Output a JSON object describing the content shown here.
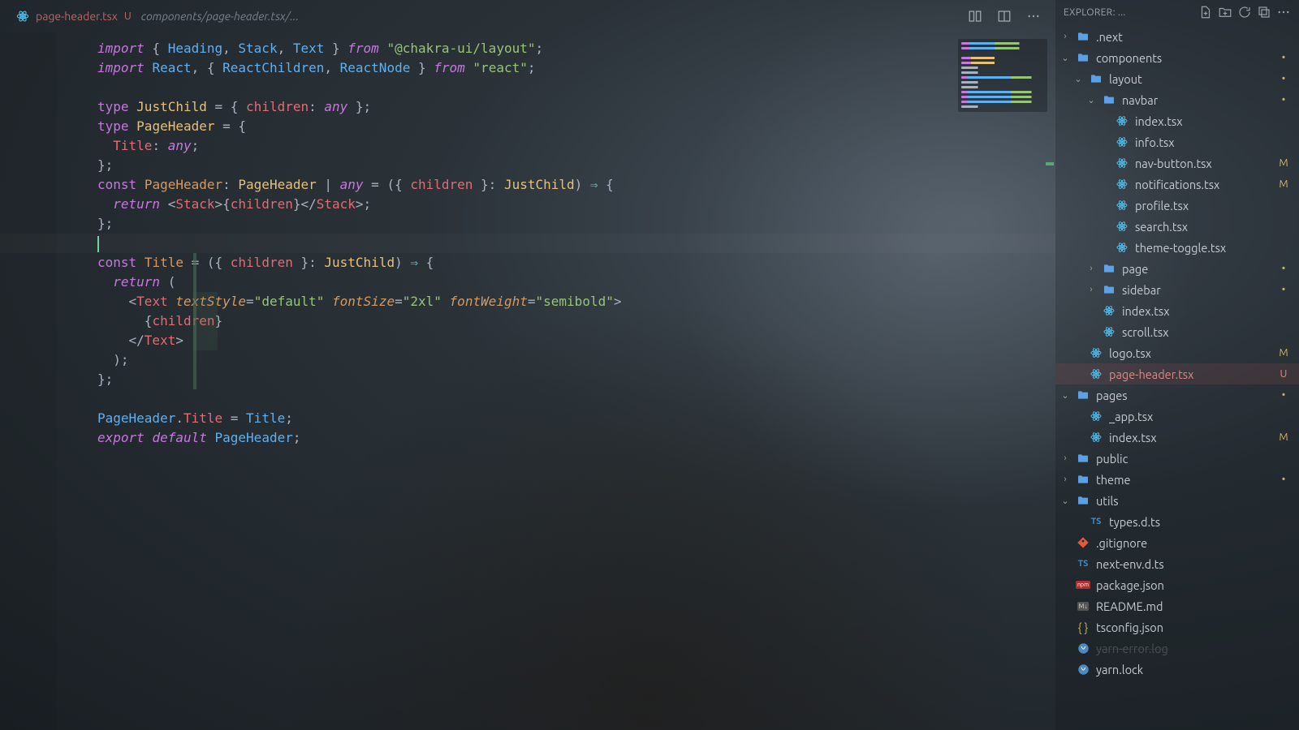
{
  "tab": {
    "filename": "page-header.tsx",
    "status": "U",
    "path": "components/page-header.tsx/..."
  },
  "explorer": {
    "title": "EXPLORER: ..."
  },
  "code_lines": [
    [
      [
        "k",
        "import"
      ],
      [
        "p",
        " { "
      ],
      [
        "fn",
        "Heading"
      ],
      [
        "p",
        ", "
      ],
      [
        "fn",
        "Stack"
      ],
      [
        "p",
        ", "
      ],
      [
        "fn",
        "Text"
      ],
      [
        "p",
        " } "
      ],
      [
        "k",
        "from"
      ],
      [
        "p",
        " "
      ],
      [
        "s",
        "\"@chakra-ui/layout\""
      ],
      [
        "p",
        ";"
      ]
    ],
    [
      [
        "k",
        "import"
      ],
      [
        "p",
        " "
      ],
      [
        "fn",
        "React"
      ],
      [
        "p",
        ", { "
      ],
      [
        "fn",
        "ReactChildren"
      ],
      [
        "p",
        ", "
      ],
      [
        "fn",
        "ReactNode"
      ],
      [
        "p",
        " } "
      ],
      [
        "k",
        "from"
      ],
      [
        "p",
        " "
      ],
      [
        "s",
        "\"react\""
      ],
      [
        "p",
        ";"
      ]
    ],
    [],
    [
      [
        "kt",
        "type"
      ],
      [
        "p",
        " "
      ],
      [
        "ty",
        "JustChild"
      ],
      [
        "p",
        " = { "
      ],
      [
        "pr",
        "children"
      ],
      [
        "p",
        ": "
      ],
      [
        "k",
        "any"
      ],
      [
        "p",
        " };"
      ]
    ],
    [
      [
        "kt",
        "type"
      ],
      [
        "p",
        " "
      ],
      [
        "ty",
        "PageHeader"
      ],
      [
        "p",
        " = {"
      ]
    ],
    [
      [
        "p",
        "  "
      ],
      [
        "pr",
        "Title"
      ],
      [
        "p",
        ": "
      ],
      [
        "k",
        "any"
      ],
      [
        "p",
        ";"
      ]
    ],
    [
      [
        "p",
        "};"
      ]
    ],
    [
      [
        "kt",
        "const"
      ],
      [
        "p",
        " "
      ],
      [
        "id",
        "PageHeader"
      ],
      [
        "p",
        ": "
      ],
      [
        "ty",
        "PageHeader"
      ],
      [
        "p",
        " | "
      ],
      [
        "k",
        "any"
      ],
      [
        "p",
        " = ({ "
      ],
      [
        "pr",
        "children"
      ],
      [
        "p",
        " }: "
      ],
      [
        "ty",
        "JustChild"
      ],
      [
        "p",
        ") "
      ],
      [
        "op",
        "⇒"
      ],
      [
        "p",
        " {"
      ]
    ],
    [
      [
        "p",
        "  "
      ],
      [
        "k",
        "return"
      ],
      [
        "p",
        " <"
      ],
      [
        "tag",
        "Stack"
      ],
      [
        "p",
        ">{"
      ],
      [
        "pr",
        "children"
      ],
      [
        "p",
        "}</"
      ],
      [
        "tag",
        "Stack"
      ],
      [
        "p",
        ">;"
      ]
    ],
    [
      [
        "p",
        "};"
      ]
    ],
    [],
    [
      [
        "kt",
        "const"
      ],
      [
        "p",
        " "
      ],
      [
        "id",
        "Title"
      ],
      [
        "p",
        " = ({ "
      ],
      [
        "pr",
        "children"
      ],
      [
        "p",
        " }: "
      ],
      [
        "ty",
        "JustChild"
      ],
      [
        "p",
        ") "
      ],
      [
        "op",
        "⇒"
      ],
      [
        "p",
        " {"
      ]
    ],
    [
      [
        "p",
        "  "
      ],
      [
        "k",
        "return"
      ],
      [
        "p",
        " ("
      ]
    ],
    [
      [
        "p",
        "    <"
      ],
      [
        "tag",
        "Text"
      ],
      [
        "p",
        " "
      ],
      [
        "at",
        "textStyle"
      ],
      [
        "p",
        "="
      ],
      [
        "s",
        "\"default\""
      ],
      [
        "p",
        " "
      ],
      [
        "at",
        "fontSize"
      ],
      [
        "p",
        "="
      ],
      [
        "s",
        "\"2xl\""
      ],
      [
        "p",
        " "
      ],
      [
        "at",
        "fontWeight"
      ],
      [
        "p",
        "="
      ],
      [
        "s",
        "\"semibold\""
      ],
      [
        "p",
        ">"
      ]
    ],
    [
      [
        "p",
        "      {"
      ],
      [
        "pr",
        "children"
      ],
      [
        "p",
        "}"
      ]
    ],
    [
      [
        "p",
        "    </"
      ],
      [
        "tag",
        "Text"
      ],
      [
        "p",
        ">"
      ]
    ],
    [
      [
        "p",
        "  );"
      ]
    ],
    [
      [
        "p",
        "};"
      ]
    ],
    [],
    [
      [
        "fn",
        "PageHeader"
      ],
      [
        "p",
        "."
      ],
      [
        "pr",
        "Title"
      ],
      [
        "p",
        " = "
      ],
      [
        "fn",
        "Title"
      ],
      [
        "p",
        ";"
      ]
    ],
    [
      [
        "k",
        "export"
      ],
      [
        "p",
        " "
      ],
      [
        "k",
        "default"
      ],
      [
        "p",
        " "
      ],
      [
        "fn",
        "PageHeader"
      ],
      [
        "p",
        ";"
      ]
    ]
  ],
  "highlight_line": 10,
  "tree": [
    {
      "indent": 0,
      "chev": "right",
      "kind": "folder",
      "label": ".next",
      "status": ""
    },
    {
      "indent": 0,
      "chev": "down",
      "kind": "folder",
      "label": "components",
      "status": "dot"
    },
    {
      "indent": 1,
      "chev": "down",
      "kind": "folder",
      "label": "layout",
      "status": "dot"
    },
    {
      "indent": 2,
      "chev": "down",
      "kind": "folder",
      "label": "navbar",
      "status": "dot"
    },
    {
      "indent": 3,
      "chev": "",
      "kind": "react",
      "label": "index.tsx",
      "status": ""
    },
    {
      "indent": 3,
      "chev": "",
      "kind": "react",
      "label": "info.tsx",
      "status": ""
    },
    {
      "indent": 3,
      "chev": "",
      "kind": "react",
      "label": "nav-button.tsx",
      "status": "M"
    },
    {
      "indent": 3,
      "chev": "",
      "kind": "react",
      "label": "notifications.tsx",
      "status": "M"
    },
    {
      "indent": 3,
      "chev": "",
      "kind": "react",
      "label": "profile.tsx",
      "status": ""
    },
    {
      "indent": 3,
      "chev": "",
      "kind": "react",
      "label": "search.tsx",
      "status": ""
    },
    {
      "indent": 3,
      "chev": "",
      "kind": "react",
      "label": "theme-toggle.tsx",
      "status": ""
    },
    {
      "indent": 2,
      "chev": "right",
      "kind": "folder",
      "label": "page",
      "status": "dot"
    },
    {
      "indent": 2,
      "chev": "right",
      "kind": "folder",
      "label": "sidebar",
      "status": "dot"
    },
    {
      "indent": 2,
      "chev": "",
      "kind": "react",
      "label": "index.tsx",
      "status": ""
    },
    {
      "indent": 2,
      "chev": "",
      "kind": "react",
      "label": "scroll.tsx",
      "status": ""
    },
    {
      "indent": 1,
      "chev": "",
      "kind": "react",
      "label": "logo.tsx",
      "status": "M"
    },
    {
      "indent": 1,
      "chev": "",
      "kind": "react",
      "label": "page-header.tsx",
      "status": "U",
      "active": true
    },
    {
      "indent": 0,
      "chev": "down",
      "kind": "folder",
      "label": "pages",
      "status": "dot"
    },
    {
      "indent": 1,
      "chev": "",
      "kind": "react",
      "label": "_app.tsx",
      "status": ""
    },
    {
      "indent": 1,
      "chev": "",
      "kind": "react",
      "label": "index.tsx",
      "status": "M"
    },
    {
      "indent": 0,
      "chev": "right",
      "kind": "folder",
      "label": "public",
      "status": ""
    },
    {
      "indent": 0,
      "chev": "right",
      "kind": "folder",
      "label": "theme",
      "status": "dot"
    },
    {
      "indent": 0,
      "chev": "down",
      "kind": "folder",
      "label": "utils",
      "status": ""
    },
    {
      "indent": 1,
      "chev": "",
      "kind": "ts",
      "label": "types.d.ts",
      "status": ""
    },
    {
      "indent": 0,
      "chev": "",
      "kind": "git",
      "label": ".gitignore",
      "status": ""
    },
    {
      "indent": 0,
      "chev": "",
      "kind": "ts",
      "label": "next-env.d.ts",
      "status": ""
    },
    {
      "indent": 0,
      "chev": "",
      "kind": "npm",
      "label": "package.json",
      "status": ""
    },
    {
      "indent": 0,
      "chev": "",
      "kind": "md",
      "label": "README.md",
      "status": ""
    },
    {
      "indent": 0,
      "chev": "",
      "kind": "json",
      "label": "tsconfig.json",
      "status": ""
    },
    {
      "indent": 0,
      "chev": "",
      "kind": "yarn",
      "label": "yarn-error.log",
      "status": "",
      "dim": true
    },
    {
      "indent": 0,
      "chev": "",
      "kind": "yarn",
      "label": "yarn.lock",
      "status": ""
    }
  ]
}
